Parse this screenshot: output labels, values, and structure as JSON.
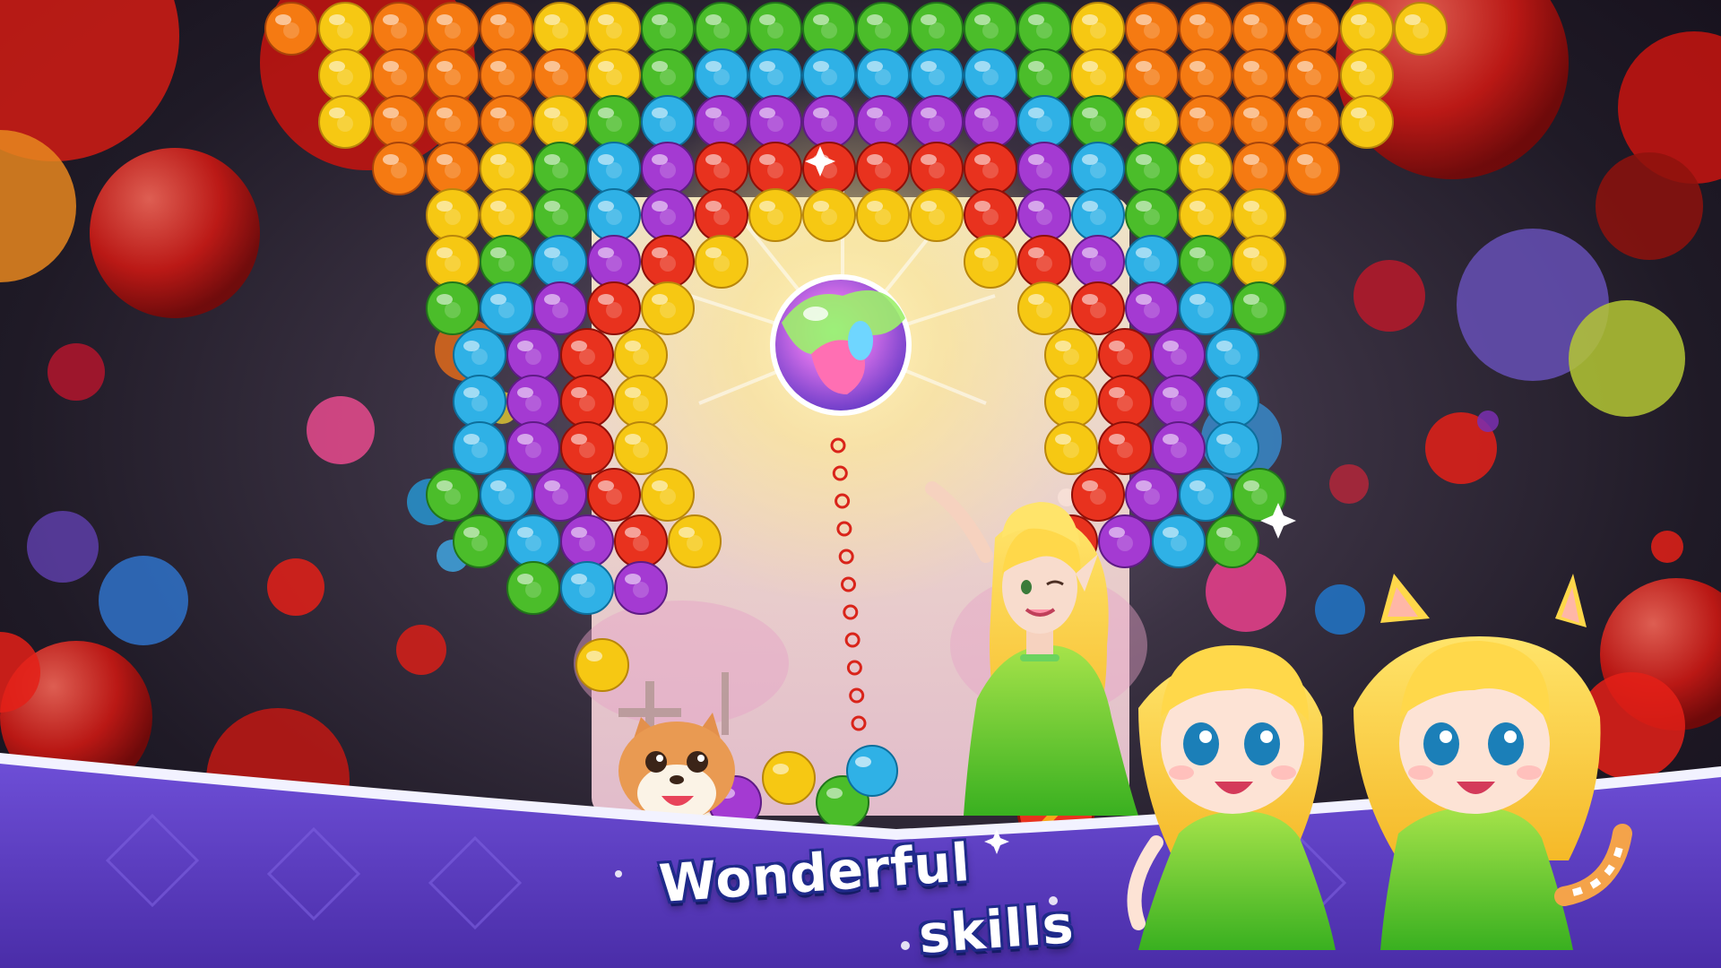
{
  "promo": {
    "title_line1": "Wonderful",
    "title_line2": "skills"
  },
  "colors": {
    "red": "#e8321e",
    "orange": "#f57a12",
    "yellow": "#f6c813",
    "green": "#4bbd2a",
    "blue": "#2fb1e6",
    "purple": "#a43ad2",
    "banner": "#5d3ec4",
    "banner_trim": "#f2f2ff"
  },
  "board": {
    "rows": [
      "OYOOOYYGGGGGGGGYOOOOYY",
      "YOOOOYGBBBBBBGYOOOOY",
      "YOOOYGBPPPPPPBGYOOOY",
      "OOYGBPRRRRRRPBGYOO",
      "YYGBPRYYYYRPBGYY",
      "YGBPRY    YRPBGY",
      "GBPRY      YRPBG",
      "BPRY       YRPB",
      "BPRY       YRPB",
      "BPRY       YRPB",
      "GBPRY       RPBG",
      "GBPRY      RPBG",
      "GBP          "
    ],
    "current_bubble": "red",
    "next_bubble": "blue"
  },
  "characters": {
    "fairy": "fairy-princess",
    "pet": "corgi-pet",
    "girl_left": "blonde-girl-green-dress",
    "girl_right": "cat-ear-girl-green-dress"
  },
  "icons": {
    "powerup": "rainbow-candy-bomb-icon",
    "aim_guide": "aim-dots-icon"
  }
}
